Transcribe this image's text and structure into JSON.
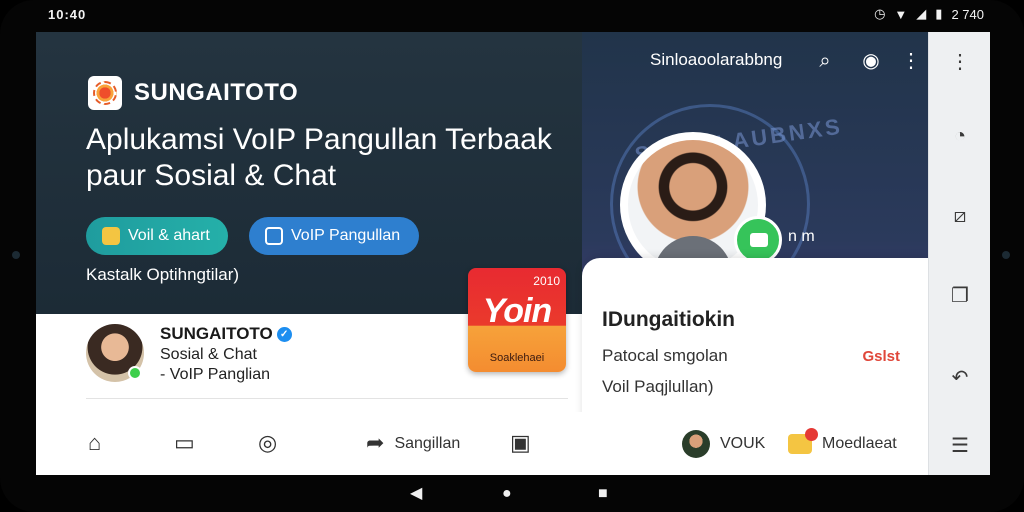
{
  "statusbar": {
    "left_time": "10:40",
    "right_time": "2 740"
  },
  "hero": {
    "brand_name": "SUNGAITOTO",
    "headline_line1": "Aplukamsi VoIP Pangullan Terbaak",
    "headline_line2": "paur Sosial & Chat",
    "pill_chat_label": "Voil & ahart",
    "pill_voip_label": "VoIP Pangullan",
    "contact_link": "Kastalk Optihngtilar)"
  },
  "profile": {
    "name": "SUNGAITOTO",
    "line1": "Sosial & Chat",
    "line2": "- VoIP Panglian"
  },
  "promo_tile": {
    "year": "2010",
    "word": "Yoin",
    "tagline": "Soaklehaei"
  },
  "right_panel": {
    "title": "Sinloaoolarabbng",
    "seal_text": "SUSIALAUBNXS",
    "side_text": "n m",
    "card_title": "IDungaitiokin",
    "card_line1": "Patocal smgolan",
    "card_line2": "Voil Paqjlullan)",
    "card_red": "Gslst"
  },
  "bottom_nav": {
    "share_label": "Sangillan",
    "voice_label": "VOUK",
    "messages_label": "Moedlaeat"
  },
  "colors": {
    "hero_bg": "#243440",
    "voip_pill": "#2e7fcf",
    "chat_pill": "#1f9c9e",
    "online": "#3ecf4c",
    "accent_red": "#e53935"
  }
}
